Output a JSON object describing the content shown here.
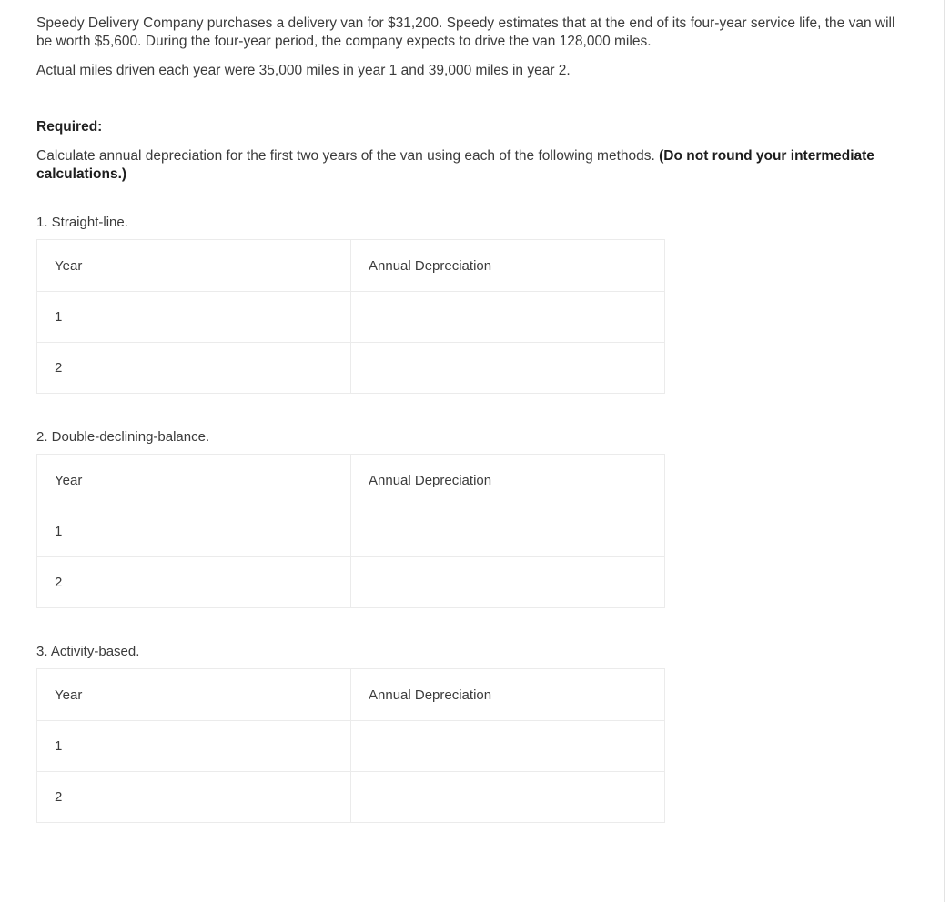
{
  "document": {
    "scenario_paragraph": "Speedy Delivery Company purchases a delivery van for $31,200. Speedy estimates that at the end of its four-year service life, the van will be worth $5,600. During the four-year period, the company expects to drive the van 128,000 miles.",
    "actual_miles_paragraph": "Actual miles driven each year were 35,000 miles in year 1 and 39,000 miles in year 2.",
    "required_label": "Required:",
    "instruction_text": "Calculate annual depreciation for the first two years of the van using each of the following methods. ",
    "instruction_bold": "(Do not round your intermediate calculations.)"
  },
  "sections": [
    {
      "heading": "1. Straight-line.",
      "table": {
        "columns": [
          "Year",
          "Annual Depreciation"
        ],
        "rows": [
          {
            "year": "1",
            "annual_depreciation": ""
          },
          {
            "year": "2",
            "annual_depreciation": ""
          }
        ]
      }
    },
    {
      "heading": "2. Double-declining-balance.",
      "table": {
        "columns": [
          "Year",
          "Annual Depreciation"
        ],
        "rows": [
          {
            "year": "1",
            "annual_depreciation": ""
          },
          {
            "year": "2",
            "annual_depreciation": ""
          }
        ]
      }
    },
    {
      "heading": "3. Activity-based.",
      "table": {
        "columns": [
          "Year",
          "Annual Depreciation"
        ],
        "rows": [
          {
            "year": "1",
            "annual_depreciation": ""
          },
          {
            "year": "2",
            "annual_depreciation": ""
          }
        ]
      }
    }
  ],
  "colors": {
    "body_text": "#3b3b3b",
    "bold_text": "#1d1d1d",
    "table_border": "#ebebeb",
    "page_border": "#e3e3e3",
    "background": "#ffffff"
  }
}
